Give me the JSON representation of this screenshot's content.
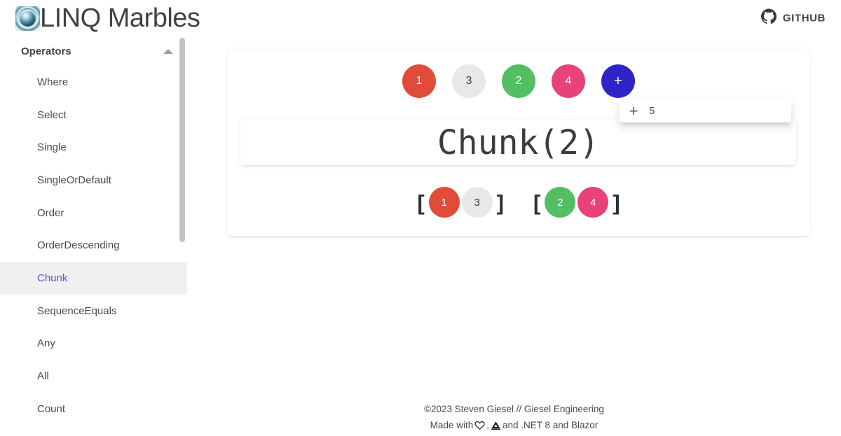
{
  "header": {
    "brand_title": "LINQ Marbles",
    "logo_icon": "marble-logo-icon",
    "github_label": "GITHUB",
    "github_icon": "github-icon"
  },
  "sidebar": {
    "group_title": "Operators",
    "group_chevron_icon": "chevron-up-icon",
    "items": [
      {
        "label": "Where",
        "active": false
      },
      {
        "label": "Select",
        "active": false
      },
      {
        "label": "Single",
        "active": false
      },
      {
        "label": "SingleOrDefault",
        "active": false
      },
      {
        "label": "Order",
        "active": false
      },
      {
        "label": "OrderDescending",
        "active": false
      },
      {
        "label": "Chunk",
        "active": true
      },
      {
        "label": "SequenceEquals",
        "active": false
      },
      {
        "label": "Any",
        "active": false
      },
      {
        "label": "All",
        "active": false
      },
      {
        "label": "Count",
        "active": false
      }
    ],
    "active_color": "#5b4ee0",
    "active_background": "#f0f0f0"
  },
  "main": {
    "operator_title": "Chunk(2)",
    "source_marbles": [
      {
        "value": "1",
        "color": "#e04c37",
        "text_color": "#ffffff"
      },
      {
        "value": "3",
        "color": "#e8e8e8",
        "text_color": "#3c3c3c"
      },
      {
        "value": "2",
        "color": "#52bf62",
        "text_color": "#ffffff"
      },
      {
        "value": "4",
        "color": "#e8417c",
        "text_color": "#ffffff"
      },
      {
        "value": "+",
        "color": "#3023c8",
        "text_color": "#ffffff"
      }
    ],
    "add_marble_icon": "plus-icon",
    "result_groups": [
      {
        "open_bracket": "[",
        "close_bracket": "]",
        "marbles": [
          {
            "value": "1",
            "color": "#e04c37",
            "text_color": "#ffffff"
          },
          {
            "value": "3",
            "color": "#e8e8e8",
            "text_color": "#3c3c3c"
          }
        ]
      },
      {
        "open_bracket": "[",
        "close_bracket": "]",
        "marbles": [
          {
            "value": "2",
            "color": "#52bf62",
            "text_color": "#ffffff"
          },
          {
            "value": "4",
            "color": "#e8417c",
            "text_color": "#ffffff"
          }
        ]
      }
    ]
  },
  "add_popup": {
    "plus_icon": "plus-icon",
    "plus_label": "+",
    "value": "5"
  },
  "footer": {
    "copyright": "©2023 Steven Giesel // Giesel Engineering",
    "made_with_prefix": "Made with",
    "heart_icon": "heart-outline-icon",
    "separator": ",",
    "tri_icon": "triangle-icon",
    "made_with_suffix": "and .NET 8 and Blazor"
  }
}
